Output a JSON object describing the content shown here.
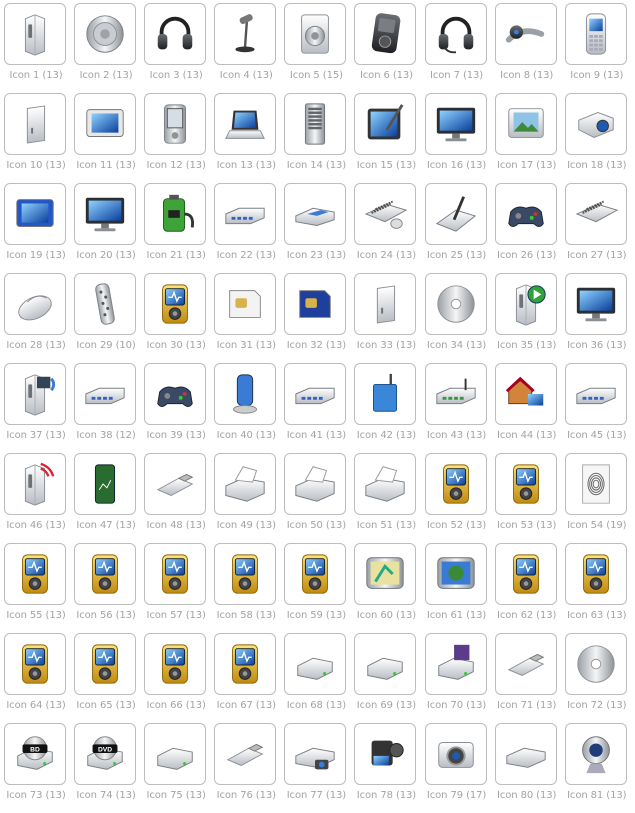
{
  "icons": [
    {
      "label": "Icon 1 (13)",
      "icon": "tower-case-icon"
    },
    {
      "label": "Icon 2 (13)",
      "icon": "speaker-icon"
    },
    {
      "label": "Icon 3 (13)",
      "icon": "headphones-icon"
    },
    {
      "label": "Icon 4 (13)",
      "icon": "microphone-stand-icon"
    },
    {
      "label": "Icon 5 (15)",
      "icon": "speaker-box-icon"
    },
    {
      "label": "Icon 6 (13)",
      "icon": "media-player-icon"
    },
    {
      "label": "Icon 7 (13)",
      "icon": "headset-icon"
    },
    {
      "label": "Icon 8 (13)",
      "icon": "bluetooth-headset-icon"
    },
    {
      "label": "Icon 9 (13)",
      "icon": "mobile-phone-icon"
    },
    {
      "label": "Icon 10 (13)",
      "icon": "external-drive-icon"
    },
    {
      "label": "Icon 11 (13)",
      "icon": "photo-frame-icon"
    },
    {
      "label": "Icon 12 (13)",
      "icon": "pda-icon"
    },
    {
      "label": "Icon 13 (13)",
      "icon": "laptop-icon"
    },
    {
      "label": "Icon 14 (13)",
      "icon": "server-tower-icon"
    },
    {
      "label": "Icon 15 (13)",
      "icon": "tablet-pen-icon"
    },
    {
      "label": "Icon 16 (13)",
      "icon": "monitor-icon"
    },
    {
      "label": "Icon 17 (13)",
      "icon": "picture-frame-icon"
    },
    {
      "label": "Icon 18 (13)",
      "icon": "projector-icon"
    },
    {
      "label": "Icon 19 (13)",
      "icon": "display-icon"
    },
    {
      "label": "Icon 20 (13)",
      "icon": "widescreen-monitor-icon"
    },
    {
      "label": "Icon 21 (13)",
      "icon": "battery-plug-icon"
    },
    {
      "label": "Icon 22 (13)",
      "icon": "network-switch-icon"
    },
    {
      "label": "Icon 23 (13)",
      "icon": "card-reader-icon"
    },
    {
      "label": "Icon 24 (13)",
      "icon": "keyboard-mouse-icon"
    },
    {
      "label": "Icon 25 (13)",
      "icon": "drawing-tablet-icon"
    },
    {
      "label": "Icon 26 (13)",
      "icon": "gamepad-icon"
    },
    {
      "label": "Icon 27 (13)",
      "icon": "keyboard-icon"
    },
    {
      "label": "Icon 28 (13)",
      "icon": "mouse-icon"
    },
    {
      "label": "Icon 29 (10)",
      "icon": "remote-control-icon"
    },
    {
      "label": "Icon 30 (13)",
      "icon": "portable-player-icon"
    },
    {
      "label": "Icon 31 (13)",
      "icon": "sim-card-icon"
    },
    {
      "label": "Icon 32 (13)",
      "icon": "memory-card-icon"
    },
    {
      "label": "Icon 33 (13)",
      "icon": "folder-device-icon"
    },
    {
      "label": "Icon 34 (13)",
      "icon": "cd-icon"
    },
    {
      "label": "Icon 35 (13)",
      "icon": "tower-play-icon"
    },
    {
      "label": "Icon 36 (13)",
      "icon": "flat-monitor-icon"
    },
    {
      "label": "Icon 37 (13)",
      "icon": "media-center-icon"
    },
    {
      "label": "Icon 38 (12)",
      "icon": "set-top-box-icon"
    },
    {
      "label": "Icon 39 (13)",
      "icon": "game-console-icon"
    },
    {
      "label": "Icon 40 (13)",
      "icon": "phone-dock-icon"
    },
    {
      "label": "Icon 41 (13)",
      "icon": "modem-icon"
    },
    {
      "label": "Icon 42 (13)",
      "icon": "wireless-router-icon"
    },
    {
      "label": "Icon 43 (13)",
      "icon": "network-adapter-icon"
    },
    {
      "label": "Icon 44 (13)",
      "icon": "home-network-icon"
    },
    {
      "label": "Icon 45 (13)",
      "icon": "router-icon"
    },
    {
      "label": "Icon 46 (13)",
      "icon": "wireless-tower-icon"
    },
    {
      "label": "Icon 47 (13)",
      "icon": "wireless-card-icon"
    },
    {
      "label": "Icon 48 (13)",
      "icon": "usb-adapter-icon"
    },
    {
      "label": "Icon 49 (13)",
      "icon": "fax-icon"
    },
    {
      "label": "Icon 50 (13)",
      "icon": "multifunction-printer-icon"
    },
    {
      "label": "Icon 51 (13)",
      "icon": "printer-icon"
    },
    {
      "label": "Icon 52 (13)",
      "icon": "portable-player-heartbeat-icon"
    },
    {
      "label": "Icon 53 (13)",
      "icon": "portable-player-user-icon"
    },
    {
      "label": "Icon 54 (19)",
      "icon": "fingerprint-reader-icon"
    },
    {
      "label": "Icon 55 (13)",
      "icon": "portable-player-sound-icon"
    },
    {
      "label": "Icon 56 (13)",
      "icon": "portable-player-video-icon"
    },
    {
      "label": "Icon 57 (13)",
      "icon": "portable-player-weather-icon"
    },
    {
      "label": "Icon 58 (13)",
      "icon": "portable-player-thermometer-icon"
    },
    {
      "label": "Icon 59 (13)",
      "icon": "portable-player-settings-icon"
    },
    {
      "label": "Icon 60 (13)",
      "icon": "gps-navigator-icon"
    },
    {
      "label": "Icon 61 (13)",
      "icon": "portable-globe-icon"
    },
    {
      "label": "Icon 62 (13)",
      "icon": "portable-player-media-icon"
    },
    {
      "label": "Icon 63 (13)",
      "icon": "portable-player-speaker-icon"
    },
    {
      "label": "Icon 64 (13)",
      "icon": "portable-player-fan-icon"
    },
    {
      "label": "Icon 65 (13)",
      "icon": "portable-player-window-icon"
    },
    {
      "label": "Icon 66 (13)",
      "icon": "portable-player-signal-icon"
    },
    {
      "label": "Icon 67 (13)",
      "icon": "portable-player-barcode-icon"
    },
    {
      "label": "Icon 68 (13)",
      "icon": "hard-drive-icon"
    },
    {
      "label": "Icon 69 (13)",
      "icon": "network-drive-icon"
    },
    {
      "label": "Icon 70 (13)",
      "icon": "floppy-drive-icon"
    },
    {
      "label": "Icon 71 (13)",
      "icon": "usb-drive-icon"
    },
    {
      "label": "Icon 72 (13)",
      "icon": "optical-drive-icon"
    },
    {
      "label": "Icon 73 (13)",
      "icon": "bluray-drive-icon",
      "badge": "BD"
    },
    {
      "label": "Icon 74 (13)",
      "icon": "dvd-drive-icon",
      "badge": "DVD"
    },
    {
      "label": "Icon 75 (13)",
      "icon": "tape-drive-icon"
    },
    {
      "label": "Icon 76 (13)",
      "icon": "usb-stick-icon"
    },
    {
      "label": "Icon 77 (13)",
      "icon": "scanner-camera-icon"
    },
    {
      "label": "Icon 78 (13)",
      "icon": "video-camera-icon"
    },
    {
      "label": "Icon 79 (17)",
      "icon": "digital-camera-icon"
    },
    {
      "label": "Icon 80 (13)",
      "icon": "flatbed-scanner-icon"
    },
    {
      "label": "Icon 81 (13)",
      "icon": "webcam-icon"
    }
  ]
}
